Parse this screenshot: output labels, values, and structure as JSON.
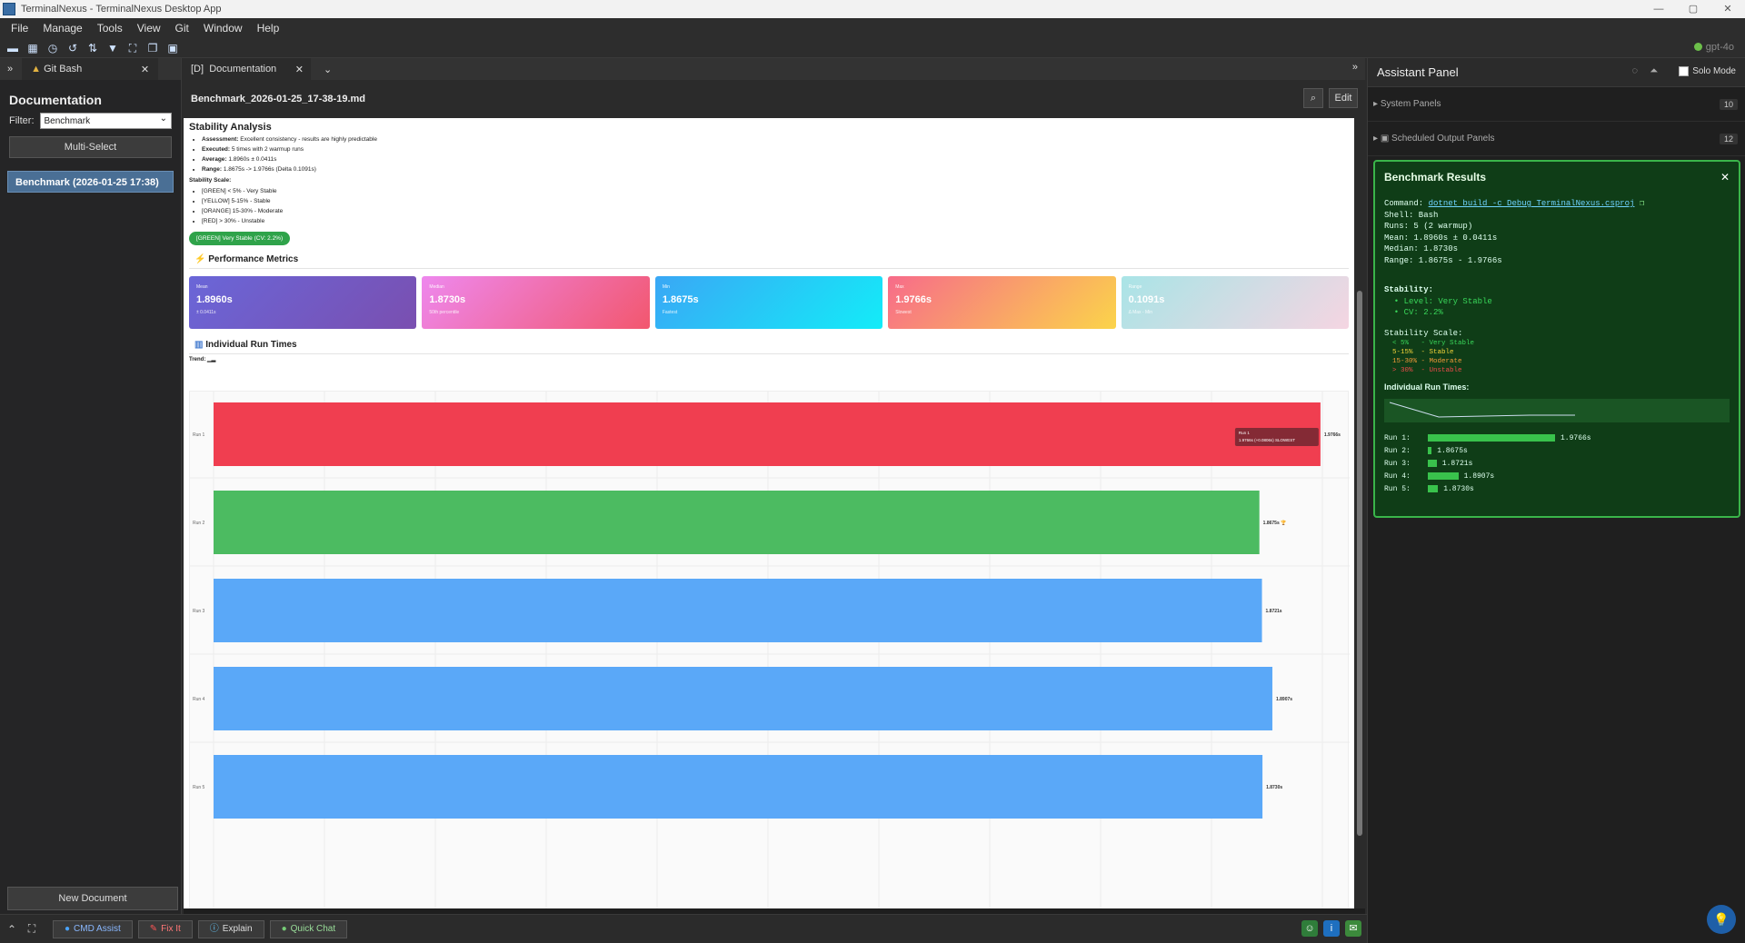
{
  "window": {
    "title": "TerminalNexus - TerminalNexus Desktop App"
  },
  "menu": [
    "File",
    "Manage",
    "Tools",
    "View",
    "Git",
    "Window",
    "Help"
  ],
  "toolbar": {
    "model": "gpt-4o"
  },
  "left": {
    "tab_label": "Git Bash",
    "title": "Documentation",
    "filter_label": "Filter:",
    "filter_value": "Benchmark",
    "multi_select": "Multi-Select",
    "doc_item": "Benchmark (2026-01-25 17:38)",
    "new_document": "New Document"
  },
  "center": {
    "tab_label": "Documentation",
    "tab_prefix": "[D]",
    "file_name": "Benchmark_2026-01-25_17-38-19.md",
    "edit_label": "Edit",
    "stability_title": "Stability Analysis",
    "assessment_label": "Assessment:",
    "assessment": "Excellent consistency - results are highly predictable",
    "executed_label": "Executed:",
    "executed": "5 times with 2 warmup runs",
    "average_label": "Average:",
    "average": "1.8960s ± 0.0411s",
    "range_label": "Range:",
    "range": "1.8675s -> 1.9766s (Delta 0.1091s)",
    "scale_title": "Stability Scale:",
    "scale": [
      "[GREEN] < 5% - Very Stable",
      "[YELLOW] 5-15% - Stable",
      "[ORANGE] 15-30% - Moderate",
      "[RED] > 30% - Unstable"
    ],
    "badge": "[GREEN] Very Stable (CV: 2.2%)",
    "perf_title": "Performance Metrics",
    "metrics": [
      {
        "label": "Mean",
        "value": "1.8960s",
        "sub": "± 0.0411s"
      },
      {
        "label": "Median",
        "value": "1.8730s",
        "sub": "50th percentile"
      },
      {
        "label": "Min",
        "value": "1.8675s",
        "sub": "Fastest"
      },
      {
        "label": "Max",
        "value": "1.9766s",
        "sub": "Slowest"
      },
      {
        "label": "Range",
        "value": "0.1091s",
        "sub": "Δ Max - Min"
      }
    ],
    "runs_title": "Individual Run Times",
    "trend_label": "Trend:",
    "tooltip_title": "Run 1",
    "tooltip_text": "1.9766s (+0.0806s) SLOWEST"
  },
  "chart_data": {
    "type": "bar",
    "orientation": "horizontal",
    "categories": [
      "Run 1",
      "Run 2",
      "Run 3",
      "Run 4",
      "Run 5"
    ],
    "values": [
      1.9766,
      1.8675,
      1.8721,
      1.8907,
      1.873
    ],
    "value_labels": [
      "1.9766s",
      "1.8675s 🏆",
      "1.8721s",
      "1.8907s",
      "1.8730s"
    ],
    "colors": [
      "#f03e50",
      "#4cbb61",
      "#5aa8f8",
      "#5aa8f8",
      "#5aa8f8"
    ],
    "xlim": [
      0,
      1.98
    ],
    "grid": true
  },
  "right": {
    "title": "Assistant Panel",
    "solo_mode": "Solo Mode",
    "system_panels": "System Panels",
    "system_count": "10",
    "scheduled_panels": "Scheduled Output Panels",
    "scheduled_count": "12",
    "bench_title": "Benchmark Results",
    "command_label": "Command:",
    "command": "dotnet build -c Debug TerminalNexus.csproj",
    "shell": "Shell: Bash",
    "runs": "Runs: 5 (2 warmup)",
    "mean": "Mean: 1.8960s ± 0.0411s",
    "median": "Median: 1.8730s",
    "range": "Range: 1.8675s - 1.9766s",
    "stability": "Stability:",
    "level": "  • Level: Very Stable",
    "cv": "  • CV: 2.2%",
    "scale_title": "Stability Scale:",
    "scale_green": "  < 5%   - Very Stable",
    "scale_yellow": "  5-15%  - Stable",
    "scale_orange": "  15-30% - Moderate",
    "scale_red": "  > 30%  - Unstable",
    "runs_title": "Individual Run Times:",
    "run_rows": [
      {
        "label": "Run 1:",
        "value": "1.9766s",
        "fraction": 1.0
      },
      {
        "label": "Run 2:",
        "value": "1.8675s",
        "fraction": 0.03
      },
      {
        "label": "Run 3:",
        "value": "1.8721s",
        "fraction": 0.07
      },
      {
        "label": "Run 4:",
        "value": "1.8907s",
        "fraction": 0.24
      },
      {
        "label": "Run 5:",
        "value": "1.8730s",
        "fraction": 0.08
      }
    ]
  },
  "bottom": {
    "cmd_assist": "CMD Assist",
    "fix_it": "Fix It",
    "explain": "Explain",
    "quick_chat": "Quick Chat"
  }
}
